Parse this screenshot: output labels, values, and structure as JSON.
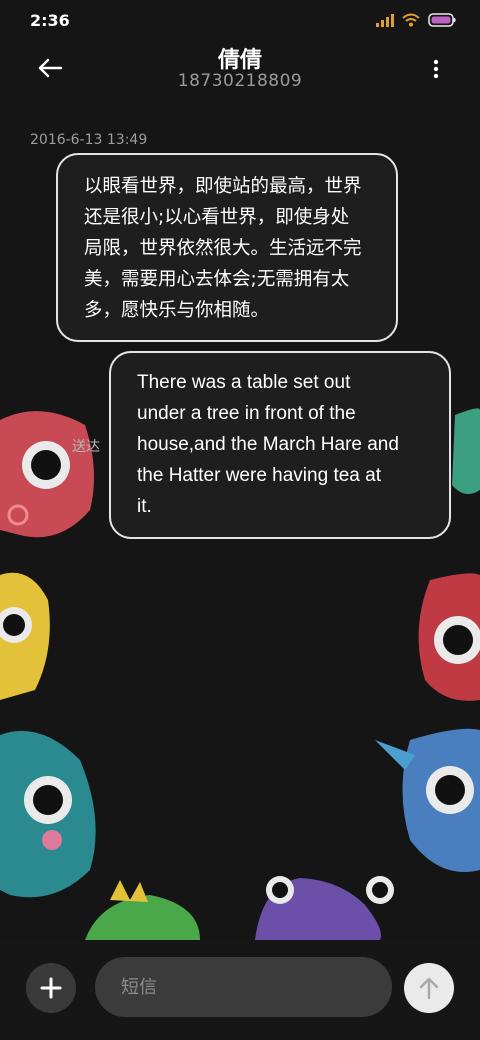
{
  "status_bar": {
    "time": "2:36",
    "icons": [
      "signal-icon",
      "wifi-icon",
      "battery-icon"
    ]
  },
  "header": {
    "back_icon": "arrow-left-icon",
    "contact_name": "倩倩",
    "contact_number": "18730218809",
    "more_icon": "more-vertical-icon"
  },
  "conversation": {
    "timestamp": "2016-6-13 13:49",
    "messages": [
      {
        "direction": "incoming",
        "lines": [
          "以眼看世界，即使站的最高，世界",
          "还是很小;以心看世界，即使身处",
          "局限，世界依然很大。生活远不完",
          "美，需要用心去体会;无需拥有太",
          "多，愿快乐与你相随。"
        ]
      },
      {
        "direction": "outgoing",
        "lines": [
          "There was a table set out",
          "under a tree in front of the",
          "house,and the March Hare and",
          "the Hatter were having tea at",
          "it."
        ],
        "status": "送达"
      }
    ]
  },
  "composer": {
    "placeholder": "短信",
    "add_icon": "plus-icon",
    "send_icon": "arrow-up-icon"
  },
  "colors": {
    "background": "#151515",
    "bubble_border": "#e4e4e4",
    "input_background": "#3b3b3b",
    "send_button": "#eaeaea"
  }
}
